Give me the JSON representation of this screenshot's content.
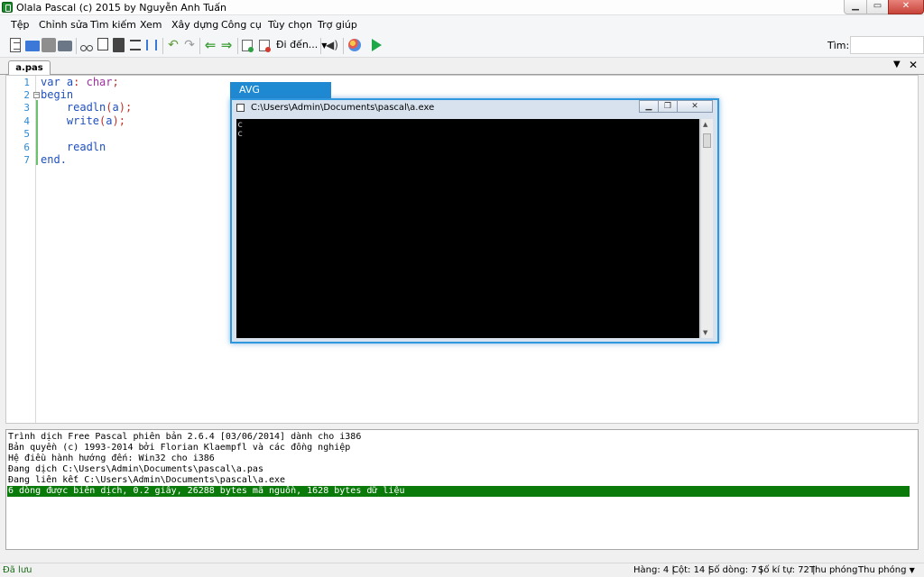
{
  "window": {
    "title": "Olala Pascal (c) 2015 by Nguyễn Anh Tuấn"
  },
  "menu": [
    "Tệp",
    "Chỉnh sửa",
    "Tìm kiếm",
    "Xem",
    "Xây dựng",
    "Công cụ",
    "Tùy chọn",
    "Trợ giúp"
  ],
  "toolbar": {
    "goto_label": "Đi đến...",
    "find_label": "Tìm:",
    "find_value": ""
  },
  "tab": {
    "name": "a.pas"
  },
  "editor": {
    "line_numbers": [
      "1",
      "2",
      "3",
      "4",
      "5",
      "6",
      "7"
    ],
    "lines": {
      "l1_kw": "var",
      "l1_id": " a",
      "l1_colon": ":",
      "l1_type": " char",
      "l1_semi": ";",
      "l2_kw": "begin",
      "l3_id": "    readln",
      "l3_open": "(",
      "l3_arg": "a",
      "l3_close": ")",
      "l3_semi": ";",
      "l4_id": "    write",
      "l4_open": "(",
      "l4_arg": "a",
      "l4_close": ")",
      "l4_semi": ";",
      "l6_id": "    readln",
      "l7_kw": "end",
      "l7_dot": "."
    }
  },
  "output": [
    "Trình dịch Free Pascal phiên bản 2.6.4 [03/06/2014] dành cho i386",
    "Bản quyền (c) 1993-2014 bởi Florian Klaempfl và các đồng nghiệp",
    "Hệ điều hành hướng đến: Win32 cho i386",
    "Đang dịch C:\\Users\\Admin\\Documents\\pascal\\a.pas",
    "Đang liên kết C:\\Users\\Admin\\Documents\\pascal\\a.exe",
    "6 dòng được biên dịch, 0.2 giây, 26288 bytes mã nguồn, 1628 bytes dữ liệu"
  ],
  "status": {
    "saved": "Đã lưu",
    "row": "Hàng: 4 |",
    "col": "Cột: 14 |",
    "lines": "Số dòng: 7 |",
    "chars": "Số kí tự: 72 |",
    "zoom1": "Thu phóng",
    "zoom2": "Thu phóng"
  },
  "console": {
    "overlay_label": "AVG CyberCapture",
    "title": "C:\\Users\\Admin\\Documents\\pascal\\a.exe",
    "output": [
      "c",
      "c"
    ]
  },
  "colors": {
    "accent": "#1f8ad2",
    "highlight": "#0a7a0a",
    "keyword": "#1f4fbf",
    "line_number": "#2c8bd6"
  }
}
